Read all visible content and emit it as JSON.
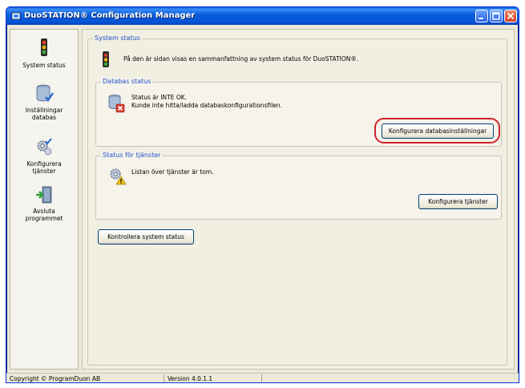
{
  "window": {
    "title": "DuoSTATION® Configuration Manager"
  },
  "sidebar": {
    "items": [
      {
        "label": "System status",
        "icon": "traffic-light-icon"
      },
      {
        "label": "Inställningar\ndatabas",
        "icon": "database-icon"
      },
      {
        "label": "Konfigurera\ntjänster",
        "icon": "gears-icon"
      },
      {
        "label": "Avsluta\nprogrammet",
        "icon": "exit-door-icon"
      }
    ]
  },
  "system_status": {
    "title": "System status",
    "description": "På den är sidan visas en sammanfattning av system status för DuoSTATION®.",
    "check_button": "Kontrollera system status"
  },
  "database_status": {
    "title": "Databas status",
    "status_line": "Status är INTE OK.",
    "detail_line": "Kunde inte hitta/ladda databaskonfigurationsfilen.",
    "configure_button": "Konfigurera databasinställningar"
  },
  "services_status": {
    "title": "Status för tjänster",
    "message": "Listan över tjänster är tom.",
    "configure_button": "Konfigurera tjänster"
  },
  "statusbar": {
    "copyright": "Copyright © ProgramDuon AB",
    "version": "Version 4.0.1.1"
  },
  "colors": {
    "titlebar": "#0a5fdc",
    "group_title": "#1e4fc8",
    "highlight": "#d1222c"
  }
}
